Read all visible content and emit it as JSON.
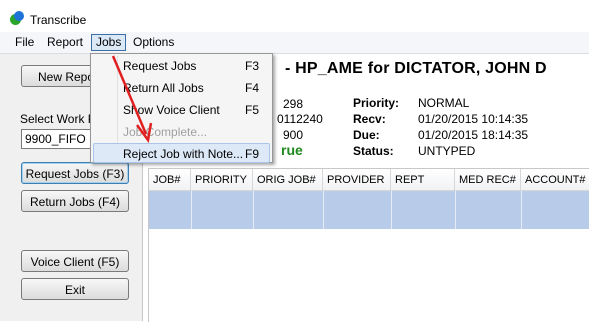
{
  "window": {
    "title": "Transcribe"
  },
  "menubar": {
    "items": [
      {
        "label": "File"
      },
      {
        "label": "Report"
      },
      {
        "label": "Jobs"
      },
      {
        "label": "Options"
      }
    ]
  },
  "jobs_menu": {
    "items": [
      {
        "label": "Request Jobs",
        "shortcut": "F3",
        "enabled": true
      },
      {
        "label": "Return All Jobs",
        "shortcut": "F4",
        "enabled": true
      },
      {
        "label": "Show Voice Client",
        "shortcut": "F5",
        "enabled": true
      },
      {
        "label": "Job Complete...",
        "shortcut": "",
        "enabled": false
      },
      {
        "label": "Reject Job with Note...",
        "shortcut": "F9",
        "enabled": true,
        "highlighted": true
      }
    ]
  },
  "left": {
    "new_report": "New Repo",
    "select_work_label": "Select Work P",
    "select_value": "9900_FIFO",
    "request_jobs": "Request Jobs (F3)",
    "return_jobs": "Return Jobs (F4)",
    "voice_client": "Voice Client (F5)",
    "exit": "Exit"
  },
  "header": {
    "title": "- HP_AME for DICTATOR, JOHN D"
  },
  "details": {
    "col1": {
      "line1": "298",
      "line2": "0112240",
      "line3": "900",
      "line4": "rue"
    },
    "priority_label": "Priority:",
    "priority_value": "NORMAL",
    "recv_label": "Recv:",
    "recv_value": "01/20/2015 10:14:35",
    "due_label": "Due:",
    "due_value": "01/20/2015 18:14:35",
    "status_label": "Status:",
    "status_value": "UNTYPED"
  },
  "table": {
    "columns": [
      "JOB#",
      "PRIORITY",
      "ORIG JOB#",
      "PROVIDER",
      "REPT TYPE",
      "MED REC#",
      "ACCOUNT#"
    ]
  },
  "colors": {
    "selection": "#b8cbe8",
    "arrow": "#e02020",
    "green_text": "#1f8a1f"
  }
}
